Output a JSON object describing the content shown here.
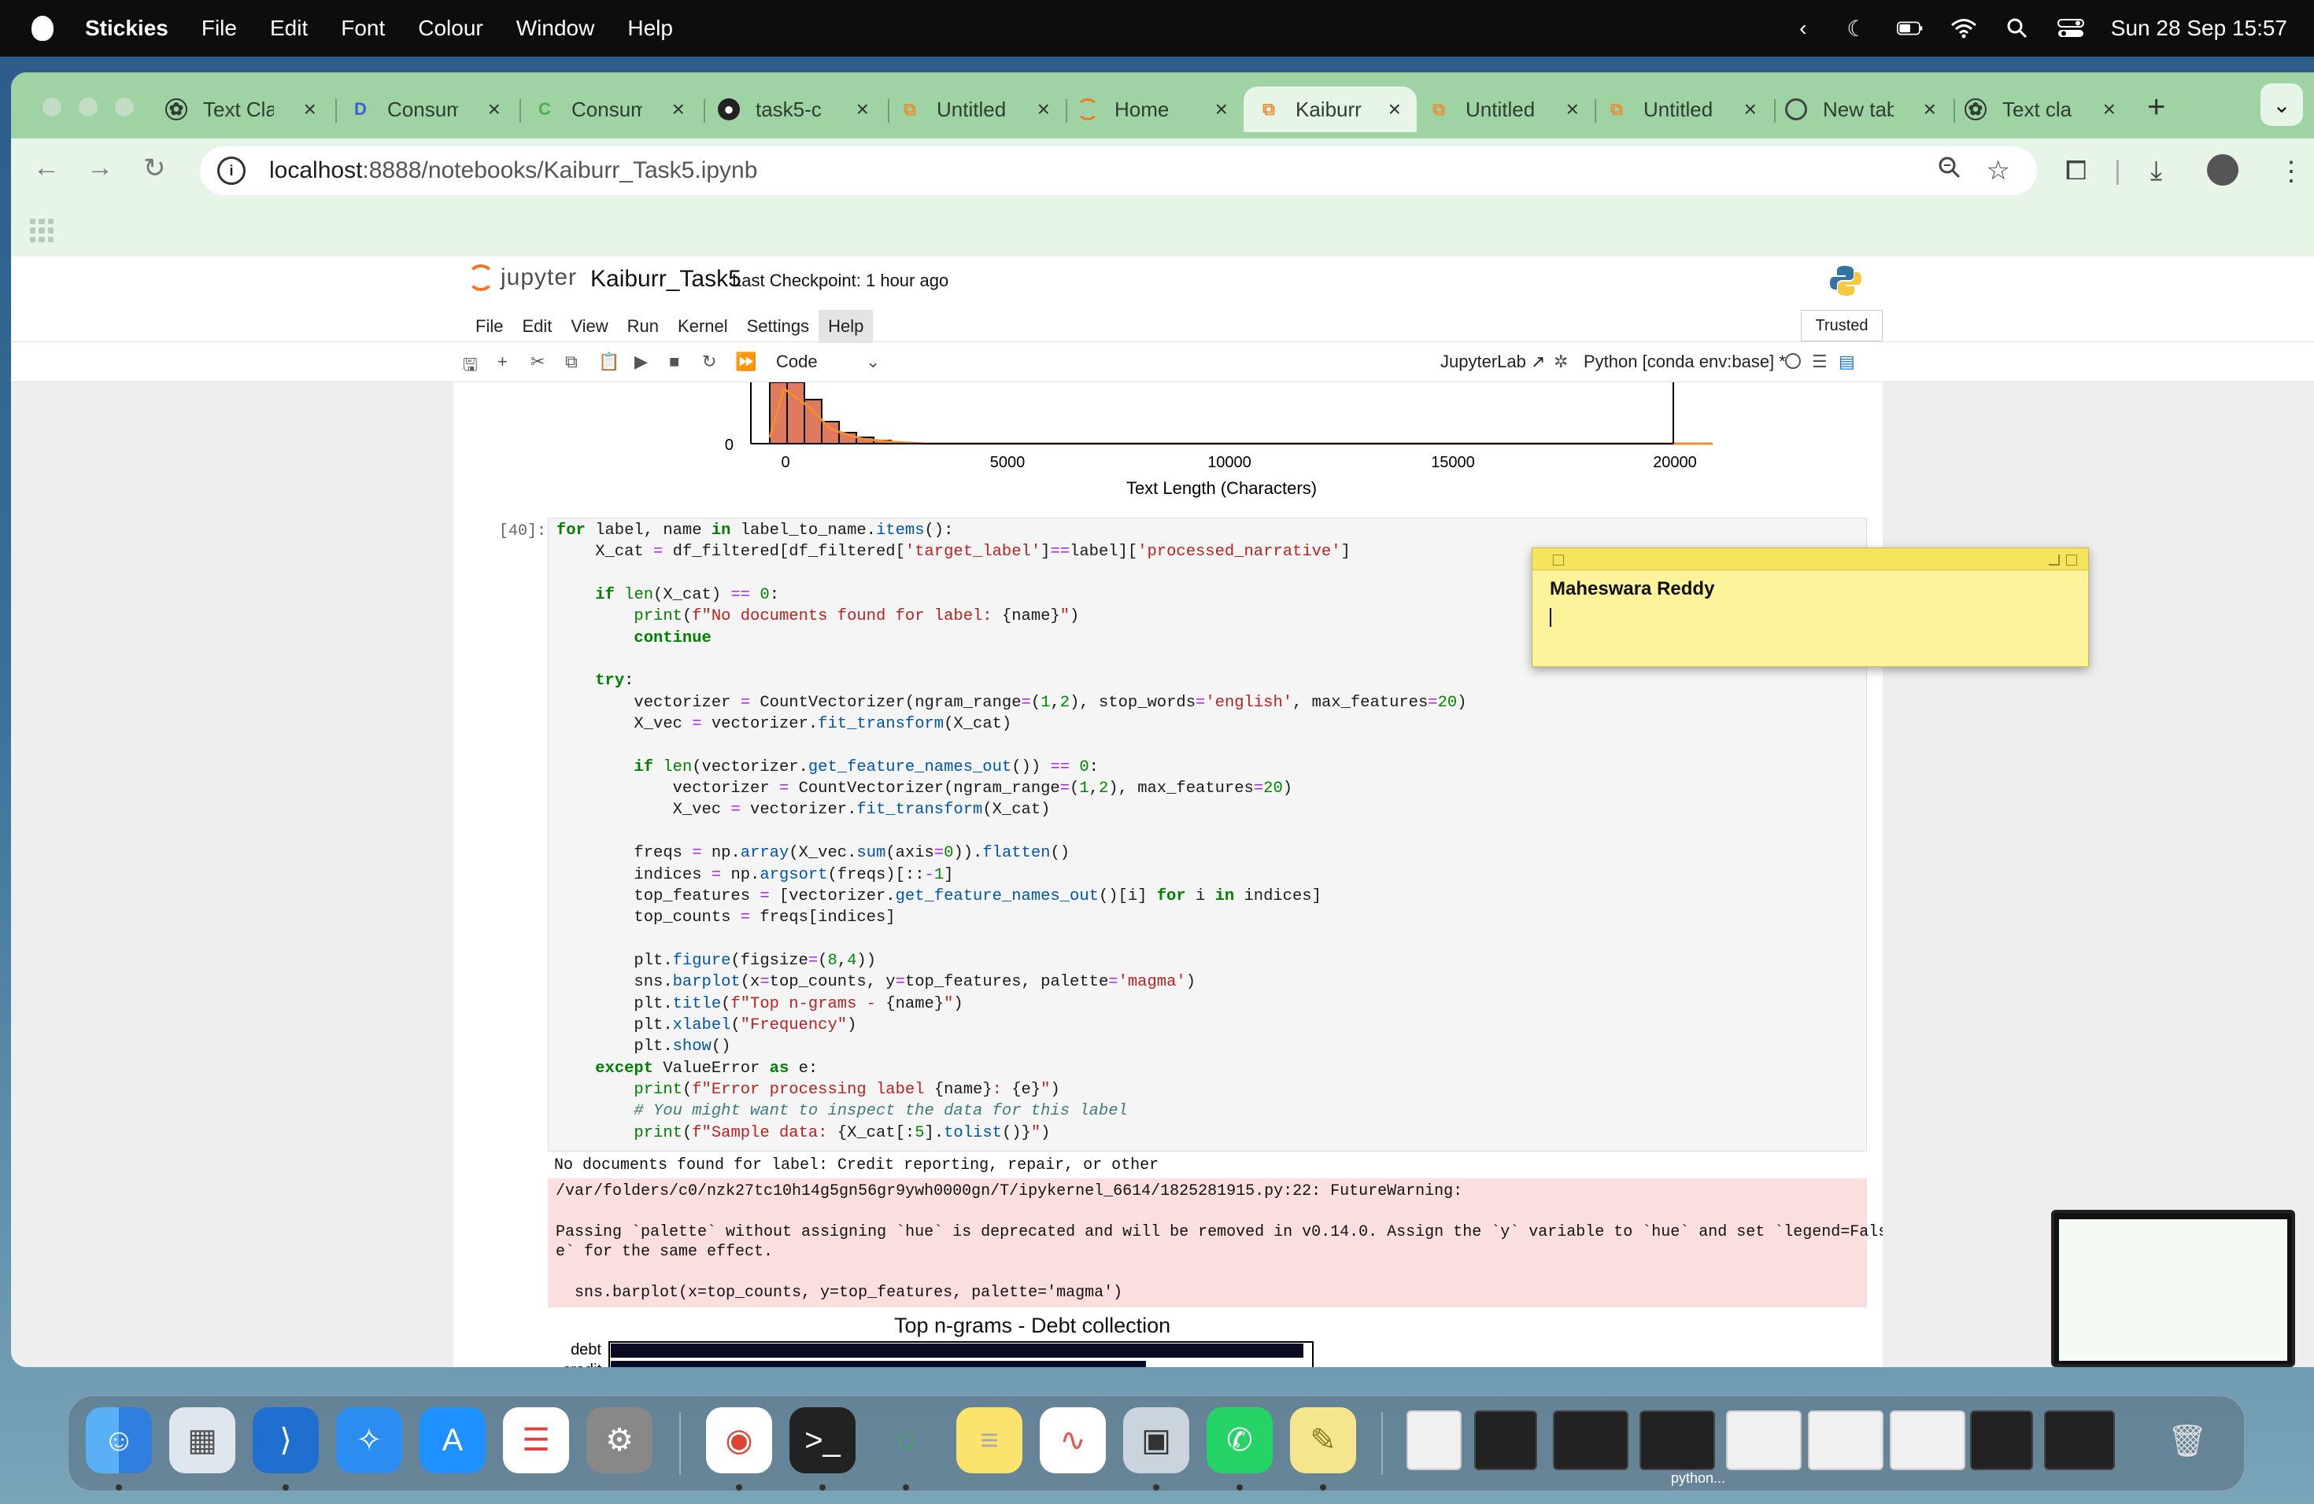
{
  "menubar": {
    "app_name": "Stickies",
    "items": [
      "File",
      "Edit",
      "Font",
      "Colour",
      "Window",
      "Help"
    ],
    "datetime": "Sun 28 Sep  15:57"
  },
  "browser": {
    "tabs": [
      {
        "label": "Text Cla",
        "icon": "openai-icon",
        "active": false
      },
      {
        "label": "Consum",
        "icon": "d-icon",
        "active": false
      },
      {
        "label": "Consum",
        "icon": "c-icon",
        "active": false
      },
      {
        "label": "task5-c",
        "icon": "github-icon",
        "active": false
      },
      {
        "label": "Untitled",
        "icon": "notebook-icon",
        "active": false
      },
      {
        "label": "Home",
        "icon": "jupyter-icon",
        "active": false
      },
      {
        "label": "Kaiburr",
        "icon": "notebook-icon",
        "active": true
      },
      {
        "label": "Untitled",
        "icon": "notebook-icon",
        "active": false
      },
      {
        "label": "Untitled",
        "icon": "notebook-icon",
        "active": false
      },
      {
        "label": "New tab",
        "icon": "chrome-icon",
        "active": false
      },
      {
        "label": "Text cla",
        "icon": "openai-icon",
        "active": false
      }
    ],
    "url_host": "localhost",
    "url_path": ":8888/notebooks/Kaiburr_Task5.ipynb"
  },
  "jupyter": {
    "logo_text": "jupyter",
    "notebook_name": "Kaiburr_Task5",
    "checkpoint": "Last Checkpoint: 1 hour ago",
    "menu": [
      "File",
      "Edit",
      "View",
      "Run",
      "Kernel",
      "Settings",
      "Help"
    ],
    "trusted": "Trusted",
    "cell_type": "Code",
    "jupyterlab_link": "JupyterLab",
    "kernel": "Python [conda env:base] *",
    "prompt": "[40]:",
    "output_line": "No documents found for label: Credit reporting, repair, or other",
    "warning_lines": [
      "/var/folders/c0/nzk27tc10h14g5gn56gr9ywh0000gn/T/ipykernel_6614/1825281915.py:22: FutureWarning:",
      "",
      "Passing `palette` without assigning `hue` is deprecated and will be removed in v0.14.0. Assign the `y` variable to `hue` and set `legend=Fals",
      "e` for the same effect.",
      "",
      "  sns.barplot(x=top_counts, y=top_features, palette='magma')"
    ]
  },
  "chart_data": [
    {
      "type": "bar",
      "title": "",
      "xlabel": "Text Length (Characters)",
      "ylabel": "",
      "xticks": [
        "0",
        "5000",
        "10000",
        "15000",
        "20000"
      ],
      "yticks": [
        "0"
      ],
      "xlim": [
        -1100,
        22500
      ],
      "colors": {
        "bars": "#e07a5f",
        "kde": "#f28e2b",
        "edge": "#000000"
      }
    },
    {
      "type": "bar",
      "title": "Top n-grams - Debt collection",
      "categories": [
        "debt",
        "credit"
      ],
      "colors": {
        "bars": "#0b0b23"
      }
    }
  ],
  "sticky": {
    "title": "Maheswara Reddy"
  },
  "dock": {
    "python_label": "python..."
  }
}
